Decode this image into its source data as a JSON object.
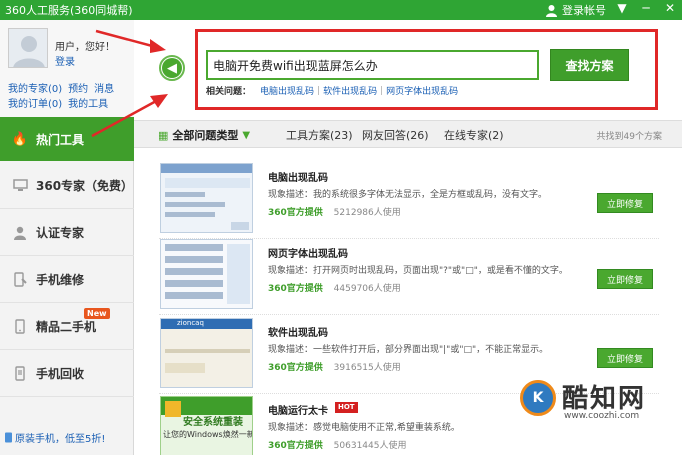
{
  "window": {
    "title": "360人工服务(360同城帮)",
    "login_label": "登录帐号",
    "controls": [
      "▼",
      "─",
      "✕"
    ]
  },
  "user": {
    "hello": "用户，您好！",
    "login": "登录",
    "links_row1": [
      "我的专家(0)",
      "预约",
      "消息"
    ],
    "links_row2": [
      "我的订单(0)",
      "我的工具"
    ]
  },
  "sidebar": {
    "items": [
      {
        "label": "热门工具",
        "icon": "flame-icon",
        "active": true
      },
      {
        "label": "360专家（免费）",
        "icon": "monitor-icon",
        "active": false
      },
      {
        "label": "认证专家",
        "icon": "person-icon",
        "active": false
      },
      {
        "label": "手机维修",
        "icon": "phone-repair-icon",
        "active": false
      },
      {
        "label": "精品二手机",
        "icon": "phone-icon",
        "active": false,
        "badge": "New"
      },
      {
        "label": "手机回收",
        "icon": "phone-recycle-icon",
        "active": false
      }
    ],
    "promo": "原装手机，低至5折!"
  },
  "search": {
    "value": "电脑开免费wifi出现蓝屏怎么办",
    "button": "查找方案",
    "related_label": "相关问题：",
    "related": [
      "电脑出现乱码",
      "软件出现乱码",
      "网页字体出现乱码"
    ]
  },
  "tabs": {
    "all": "全部问题类型",
    "items": [
      "工具方案(23)",
      "网友回答(26)",
      "在线专家(2)"
    ],
    "total": "共找到49个方案"
  },
  "results": [
    {
      "title": "电脑出现乱码",
      "desc": "现象描述：我的系统很多字体无法显示，全是方框或乱码，没有文字。",
      "source": "360官方提供",
      "users": "5212986人使用",
      "button": "立即修复"
    },
    {
      "title": "网页字体出现乱码",
      "desc": "现象描述：打开网页时出现乱码，页面出现\"?\"或\"□\"，或是看不懂的文字。",
      "source": "360官方提供",
      "users": "4459706人使用",
      "button": "立即修复"
    },
    {
      "title": "软件出现乱码",
      "desc": "现象描述：一些软件打开后，部分界面出现\"|\"或\"□\"，不能正常显示。",
      "source": "360官方提供",
      "users": "3916515人使用",
      "button": "立即修复",
      "thumb_title": "zioncaq"
    },
    {
      "title": "电脑运行太卡",
      "badge": "HOT",
      "desc": "现象描述：感觉电脑使用不正常,希望重装系统。",
      "source": "360官方提供",
      "users": "50631445人使用",
      "button": "立即修复",
      "thumb_caption": "安全系统重装",
      "thumb_sub": "让您的Windows焕然一新"
    }
  ],
  "watermark": {
    "name": "酷知网",
    "url": "www.coozhi.com",
    "logo_letter": "K"
  },
  "colors": {
    "green": "#3f9e2b",
    "titlebar": "#2fa534",
    "highlight_red": "#e02828",
    "link": "#1a5fb4"
  }
}
